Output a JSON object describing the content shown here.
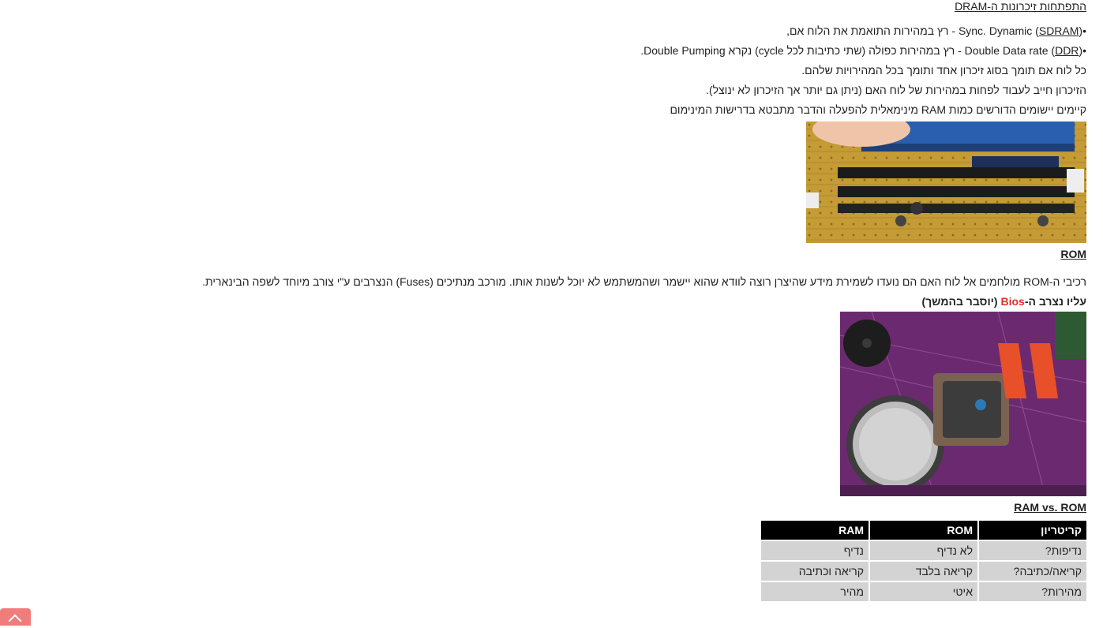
{
  "dram": {
    "title": "התפתחות זיכרונות ה-DRAM",
    "sdram": {
      "pre": "•Sync. Dynamic (",
      "link": "SDRAM",
      "post": ") - רץ במהירות התואמת את הלוח אם,"
    },
    "ddr": {
      "pre": "•Double Data rate (",
      "link": "DDR",
      "post": ") - רץ במהירות כפולה (שתי כתיבות לכל cycle) נקרא Double Pumping."
    },
    "p1": "כל לוח אם תומך בסוג זיכרון אחד ותומך בכל המהירויות שלהם.",
    "p2": "הזיכרון חייב לעבוד לפחות במהירות של לוח האם (ניתן גם יותר אך הזיכרון לא ינוצל).",
    "p3": "קיימים יישומים הדורשים כמות RAM מינימאלית להפעלה והדבר מתבטא בדרישות המינימום"
  },
  "rom": {
    "title": "ROM",
    "p1": "רכיבי ה-ROM  מולחמים אל לוח האם הם נועדו לשמירת מידע שהיצרן רוצה לוודא שהוא יישמר ושהמשתמש לא יוכל לשנות אותו. מורכב מנתיכים (Fuses) הנצרבים ע\"י צורב מיוחד לשפה הבינארית.",
    "p2_pre": "עליו נצרב ה-",
    "p2_red": "Bios",
    "p2_post": " (יוסבר בהמשך)"
  },
  "compare": {
    "title": "RAM vs. ROM",
    "headers": [
      "קריטריון",
      "ROM",
      "RAM"
    ],
    "rows": [
      [
        "נדיפות?",
        "לא נדיף",
        "נדיף"
      ],
      [
        "קריאה/כתיבה?",
        "קריאה בלבד",
        "קריאה וכתיבה"
      ],
      [
        "מהירות?",
        "איטי",
        "מהיר"
      ]
    ]
  },
  "colors": {
    "accent_red": "#e0312b",
    "back_to_top": "#f07c7c",
    "table_header": "#000000",
    "table_cell": "#d3d3d3"
  },
  "icons": {
    "back_to_top": "chevron-up-icon"
  }
}
